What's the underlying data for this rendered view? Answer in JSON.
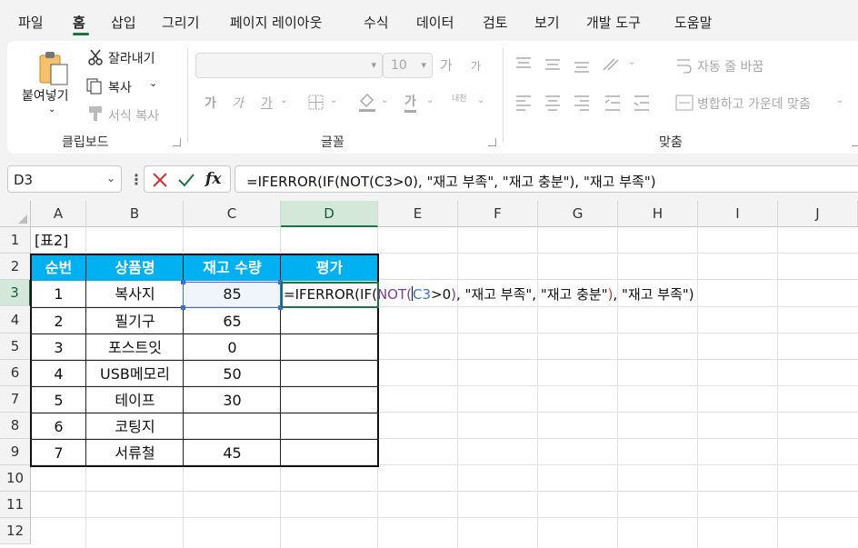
{
  "menu": {
    "tabs": [
      "파일",
      "홈",
      "삽입",
      "그리기",
      "페이지 레이아웃",
      "수식",
      "데이터",
      "검토",
      "보기",
      "개발 도구",
      "도움말"
    ],
    "active_tab": "홈"
  },
  "ribbon": {
    "clipboard": {
      "paste": "붙여넣기",
      "cut": "잘라내기",
      "copy": "복사",
      "format_painter": "서식 복사",
      "group_label": "클립보드"
    },
    "font": {
      "font_name": "",
      "font_size": "10",
      "grow": "가",
      "shrink": "가",
      "bold": "가",
      "italic": "가",
      "underline": "가",
      "font_color": "가",
      "phonetic": "내천",
      "group_label": "글꼴"
    },
    "alignment": {
      "wrap_text": "자동 줄 바꿈",
      "merge_center": "병합하고 가운데 맞춤",
      "group_label": "맞춤"
    }
  },
  "formula_bar": {
    "name_box": "D3",
    "formula": "=IFERROR(IF(NOT(C3>0), \"재고 부족\", \"재고 충분\"), \"재고 부족\")"
  },
  "sheet": {
    "columns": [
      "A",
      "B",
      "C",
      "D",
      "E",
      "F",
      "G",
      "H",
      "I",
      "J"
    ],
    "rows": [
      "1",
      "2",
      "3",
      "4",
      "5",
      "6",
      "7",
      "8",
      "9",
      "10",
      "11",
      "12"
    ],
    "selected_cell": "D3",
    "label_a1": "[표2]",
    "table_headers": [
      "순번",
      "상품명",
      "재고 수량",
      "평가"
    ],
    "table_rows": [
      {
        "num": "1",
        "name": "복사지",
        "qty": "85"
      },
      {
        "num": "2",
        "name": "필기구",
        "qty": "65"
      },
      {
        "num": "3",
        "name": "포스트잇",
        "qty": "0"
      },
      {
        "num": "4",
        "name": "USB메모리",
        "qty": "50"
      },
      {
        "num": "5",
        "name": "테이프",
        "qty": "30"
      },
      {
        "num": "6",
        "name": "코팅지",
        "qty": ""
      },
      {
        "num": "7",
        "name": "서류철",
        "qty": "45"
      }
    ],
    "edit_text_parts": [
      "=IFERROR(IF(",
      "NOT(",
      "C3",
      ">0",
      ")",
      ", \"재고 부족\", \"재고 충분\"",
      ")",
      ", \"재고 부족\")"
    ]
  },
  "colors": {
    "accent": "#1a7343",
    "table_header_bg": "#00b0f0",
    "ref_blue": "#3c6fd0"
  }
}
